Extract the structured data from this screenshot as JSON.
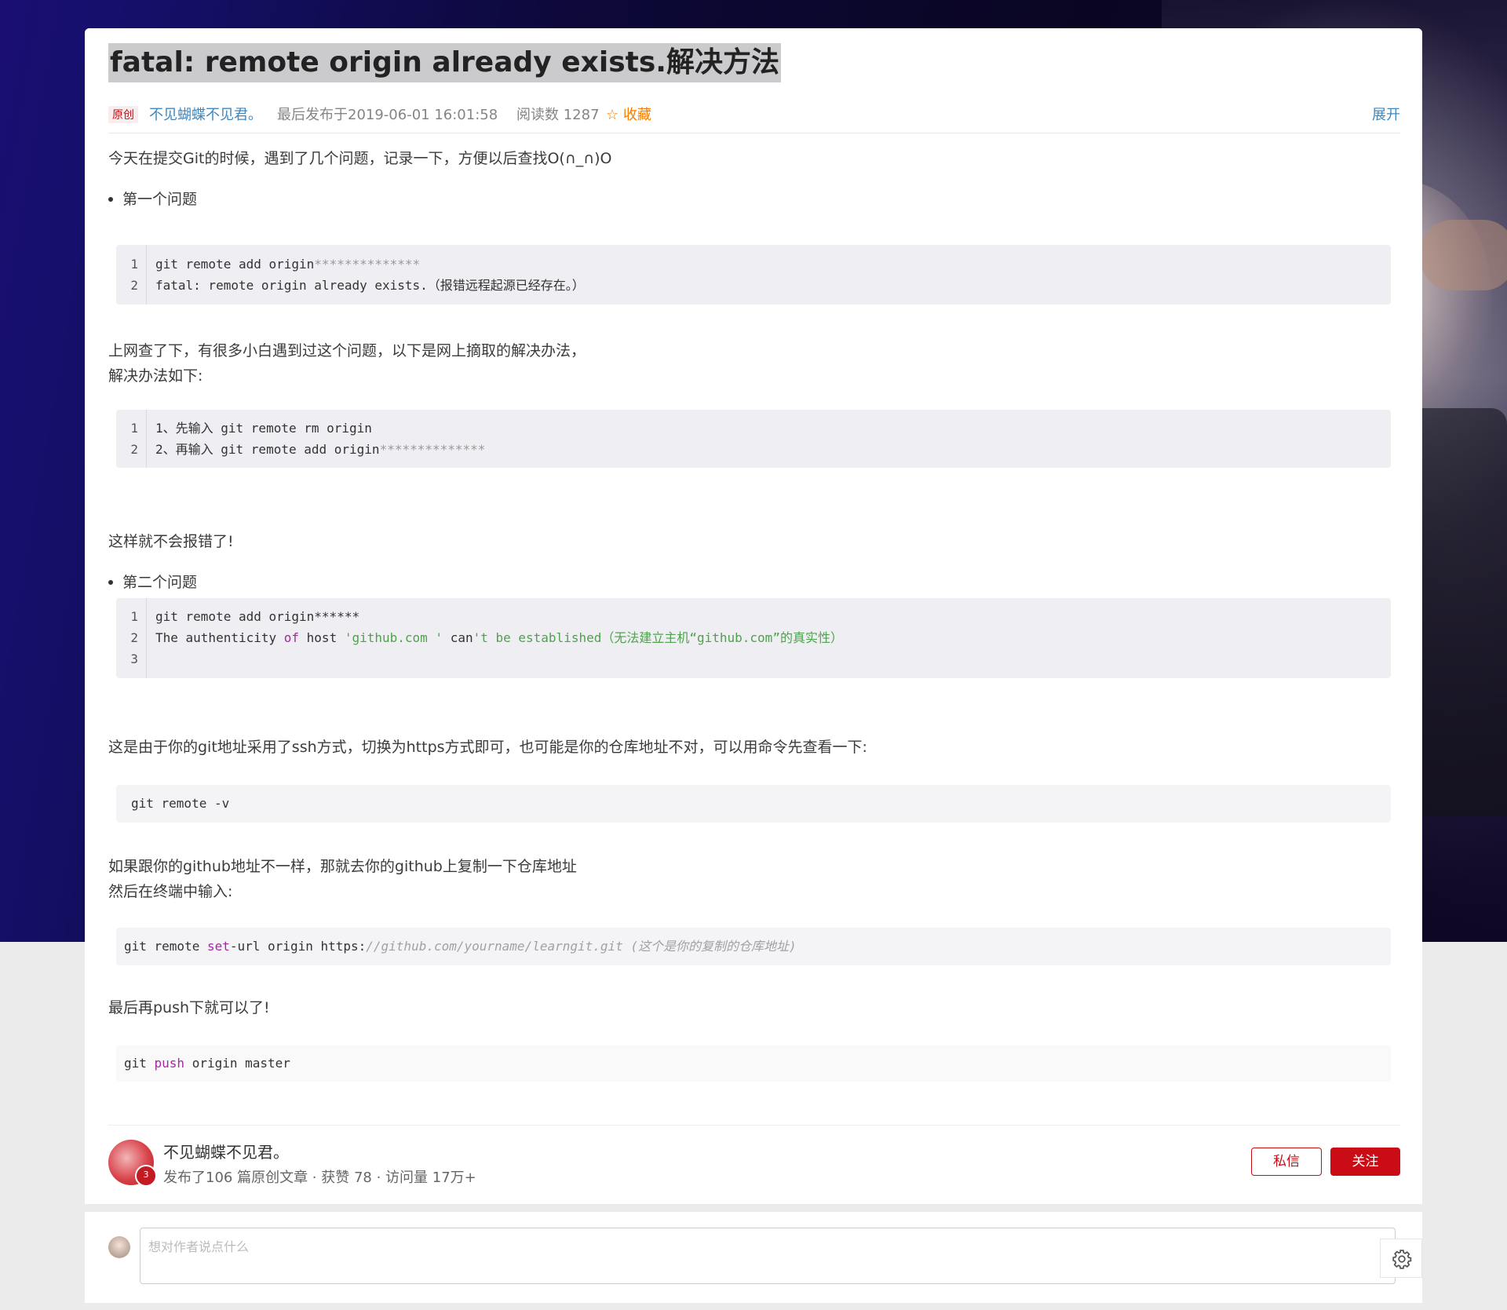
{
  "article": {
    "title": "fatal: remote origin already exists.解决方法",
    "badge": "原创",
    "author": "不见蝴蝶不见君。",
    "published": "最后发布于2019-06-01 16:01:58",
    "reads": "阅读数 1287",
    "favorite": "收藏",
    "expand": "展开",
    "p1": "今天在提交Git的时候，遇到了几个问题，记录一下，方便以后查找O(∩_∩)O",
    "bullet1": "第一个问题",
    "code1": {
      "line_numbers": [
        "1",
        "2"
      ],
      "l1_a": "git remote add origin",
      "l1_mask": "**************",
      "l2": "fatal: remote origin already exists.（报错远程起源已经存在。）"
    },
    "p2a": "上网查了下，有很多小白遇到过这个问题，以下是网上摘取的解决办法，",
    "p2b": "解决办法如下:",
    "code2": {
      "line_numbers": [
        "1",
        "2"
      ],
      "l1": "1、先输入 git remote rm origin",
      "l2_a": "2、再输入 git remote add origin",
      "l2_mask": "**************"
    },
    "p3": "这样就不会报错了!",
    "bullet2": "第二个问题",
    "code3": {
      "line_numbers": [
        "1",
        "2",
        "3"
      ],
      "l1": "git remote add origin******",
      "l2_a": "The authenticity ",
      "l2_of": "of",
      "l2_b": " host ",
      "l2_str1": "'github.com '",
      "l2_c": " can",
      "l2_str2": "'t be established（无法建立主机“github.com”的真实性）",
      "l3": ""
    },
    "p4": "这是由于你的git地址采用了ssh方式，切换为https方式即可，也可能是你的仓库地址不对，可以用命令先查看一下:",
    "code4": "git remote -v",
    "p5a": "如果跟你的github地址不一样，那就去你的github上复制一下仓库地址",
    "p5b": "然后在终端中输入:",
    "code5": {
      "a": "git remote ",
      "kw": "set",
      "b": "-url origin https:",
      "comment": "//github.com/yourname/learngit.git (这个是你的复制的仓库地址)"
    },
    "p6": "最后再push下就可以了!",
    "code6": {
      "a": "git ",
      "kw": "push",
      "b": " origin master"
    }
  },
  "author_box": {
    "name": "不见蝴蝶不见君。",
    "years": "3",
    "stats": "发布了106 篇原创文章 · 获赞 78 · 访问量 17万+",
    "message_button": "私信",
    "follow_button": "关注"
  },
  "comment": {
    "placeholder": "想对作者说点什么"
  },
  "colors": {
    "accent_red": "#ca0c16",
    "link_blue": "#3f88bf",
    "favorite_orange": "#f57c00"
  }
}
